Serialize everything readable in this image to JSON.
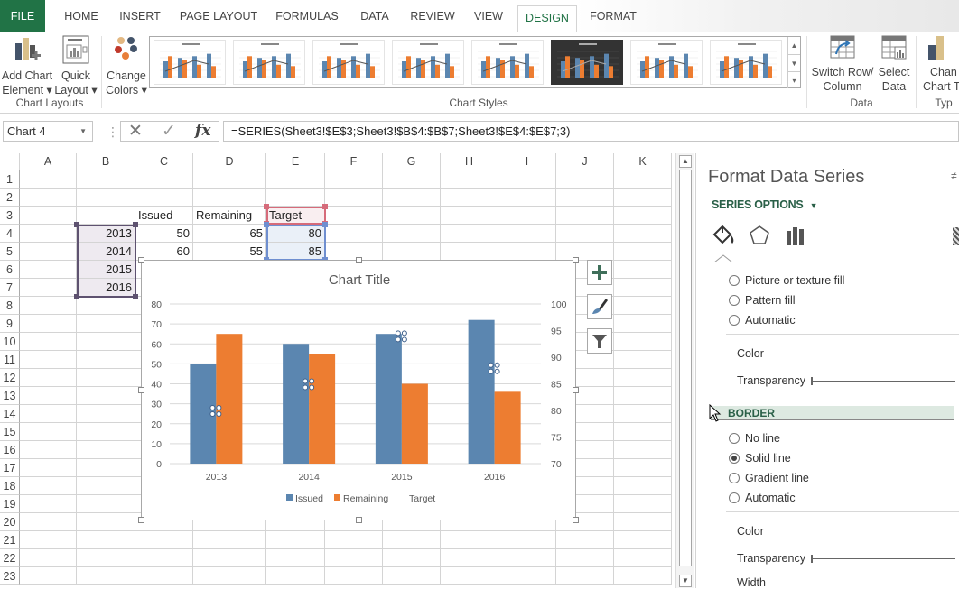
{
  "tabs": [
    {
      "label": "FILE"
    },
    {
      "label": "HOME"
    },
    {
      "label": "INSERT"
    },
    {
      "label": "PAGE LAYOUT"
    },
    {
      "label": "FORMULAS"
    },
    {
      "label": "DATA"
    },
    {
      "label": "REVIEW"
    },
    {
      "label": "VIEW"
    },
    {
      "label": "DESIGN",
      "active": true
    },
    {
      "label": "FORMAT"
    }
  ],
  "ribbon": {
    "add_chart_element": [
      "Add Chart",
      "Element ▾"
    ],
    "quick_layout": [
      "Quick",
      "Layout ▾"
    ],
    "change_colors": [
      "Change",
      "Colors ▾"
    ],
    "chart_layouts_label": "Chart Layouts",
    "chart_styles_label": "Chart Styles",
    "switch_row_column": [
      "Switch Row/",
      "Column"
    ],
    "select_data": [
      "Select",
      "Data"
    ],
    "data_label": "Data",
    "change_chart_type": [
      "Chan",
      "Chart T"
    ],
    "type_label": "Typ",
    "gallery_style_count": 8
  },
  "formula_bar": {
    "name_box": "Chart 4",
    "formula": "=SERIES(Sheet3!$E$3;Sheet3!$B$4:$B$7;Sheet3!$E$4:$E$7;3)",
    "cancel_icon": "✕",
    "enter_icon": "✓",
    "fx_label": "fx"
  },
  "sheet": {
    "columns": [
      "A",
      "B",
      "C",
      "D",
      "E",
      "F",
      "G",
      "H",
      "I",
      "J",
      "K"
    ],
    "rows": [
      "1",
      "2",
      "3",
      "4",
      "5",
      "6",
      "7",
      "8",
      "9",
      "10",
      "11",
      "12",
      "13",
      "14",
      "15",
      "16",
      "17",
      "18",
      "19",
      "20",
      "21",
      "22",
      "23"
    ],
    "headers": {
      "C3": "Issued",
      "D3": "Remaining",
      "E3": "Target"
    },
    "data": [
      {
        "year": "2013",
        "issued": "50",
        "remaining": "65",
        "target": "80"
      },
      {
        "year": "2014",
        "issued": "60",
        "remaining": "55",
        "target": "85"
      },
      {
        "year": "2015"
      },
      {
        "year": "2016"
      }
    ]
  },
  "chart_data": {
    "type": "bar",
    "title": "Chart Title",
    "categories": [
      "2013",
      "2014",
      "2015",
      "2016"
    ],
    "series": [
      {
        "name": "Issued",
        "values": [
          50,
          60,
          65,
          72
        ],
        "color": "#5b86b0",
        "axis": "primary"
      },
      {
        "name": "Remaining",
        "values": [
          65,
          55,
          40,
          36
        ],
        "color": "#ed7d31",
        "axis": "primary"
      },
      {
        "name": "Target",
        "values": [
          80,
          85,
          94,
          88
        ],
        "color": "none",
        "axis": "secondary",
        "selected": true
      }
    ],
    "y_left": {
      "min": 0,
      "max": 80,
      "ticks": [
        0,
        10,
        20,
        30,
        40,
        50,
        60,
        70,
        80
      ]
    },
    "y_right": {
      "min": 70,
      "max": 100,
      "ticks": [
        70,
        75,
        80,
        85,
        90,
        95,
        100
      ]
    },
    "xlabel": "",
    "ylabel": "",
    "grid": true,
    "legend": "bottom"
  },
  "chart_buttons": [
    {
      "name": "chart-elements-button",
      "icon": "plus-icon"
    },
    {
      "name": "chart-styles-button",
      "icon": "brush-icon"
    },
    {
      "name": "chart-filters-button",
      "icon": "filter-icon"
    }
  ],
  "pane": {
    "title": "Format Data Series",
    "series_options": "SERIES OPTIONS",
    "fill_options": [
      "Picture or texture fill",
      "Pattern fill",
      "Automatic"
    ],
    "fill_color_label": "Color",
    "fill_transparency_label": "Transparency",
    "border_header": "BORDER",
    "border_options": [
      {
        "label": "No line",
        "checked": false
      },
      {
        "label": "Solid line",
        "checked": true
      },
      {
        "label": "Gradient line",
        "checked": false
      },
      {
        "label": "Automatic",
        "checked": false
      }
    ],
    "border_color_label": "Color",
    "border_transparency_label": "Transparency",
    "width_label": "Width"
  }
}
